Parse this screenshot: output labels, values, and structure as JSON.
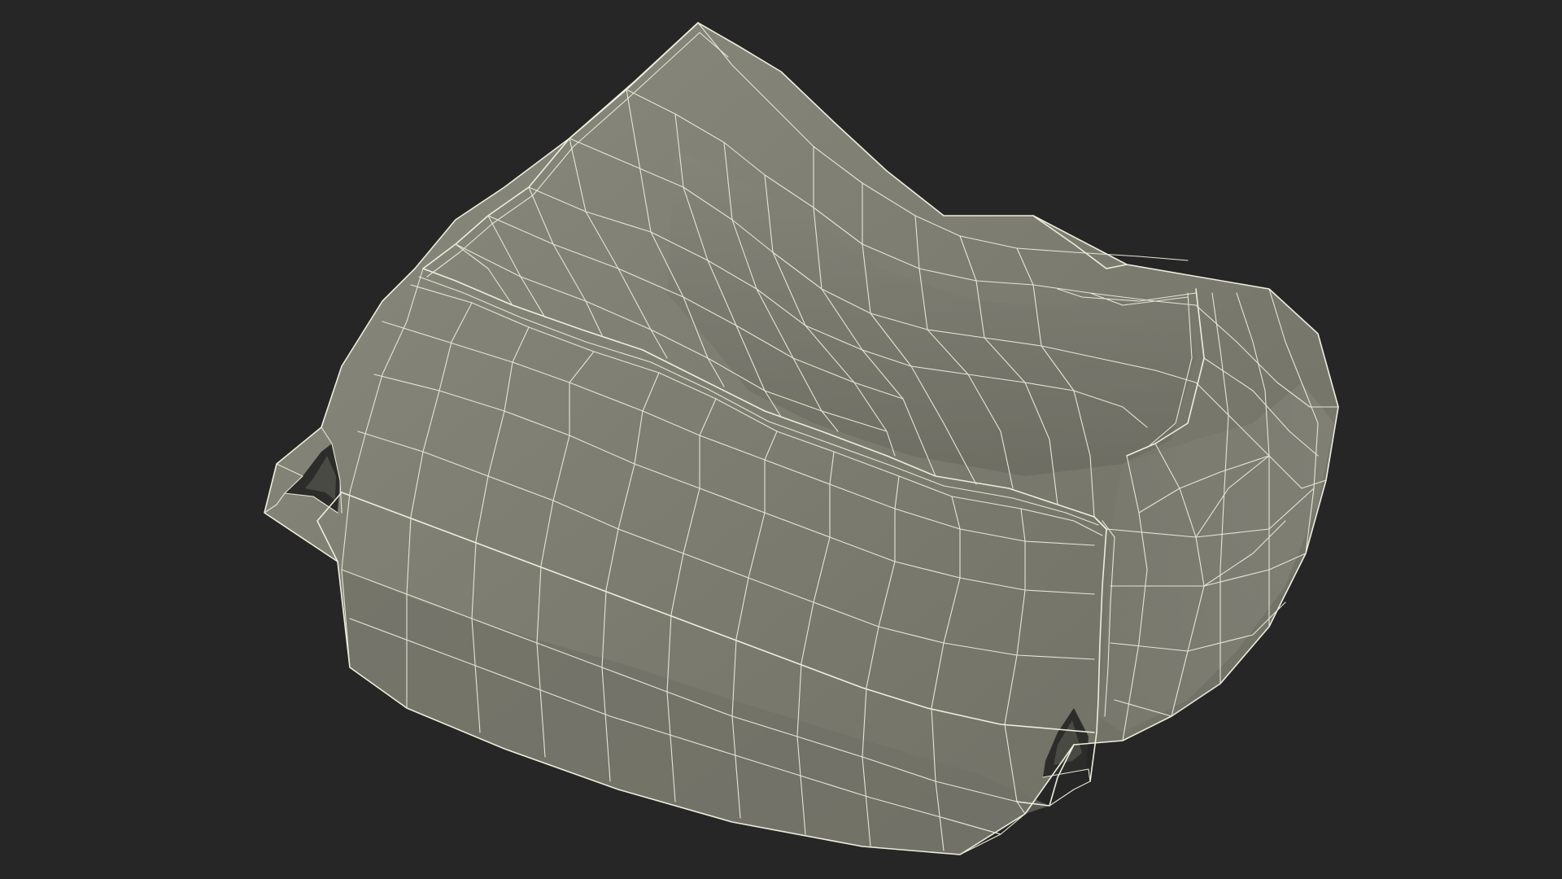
{
  "scene": {
    "subject": "beanbag-chair-wireframe",
    "background_color": "#262626",
    "surface_color": "#7e7e72",
    "surface_shadow_color": "#6a6a60",
    "wire_color": "#eeeedd"
  }
}
